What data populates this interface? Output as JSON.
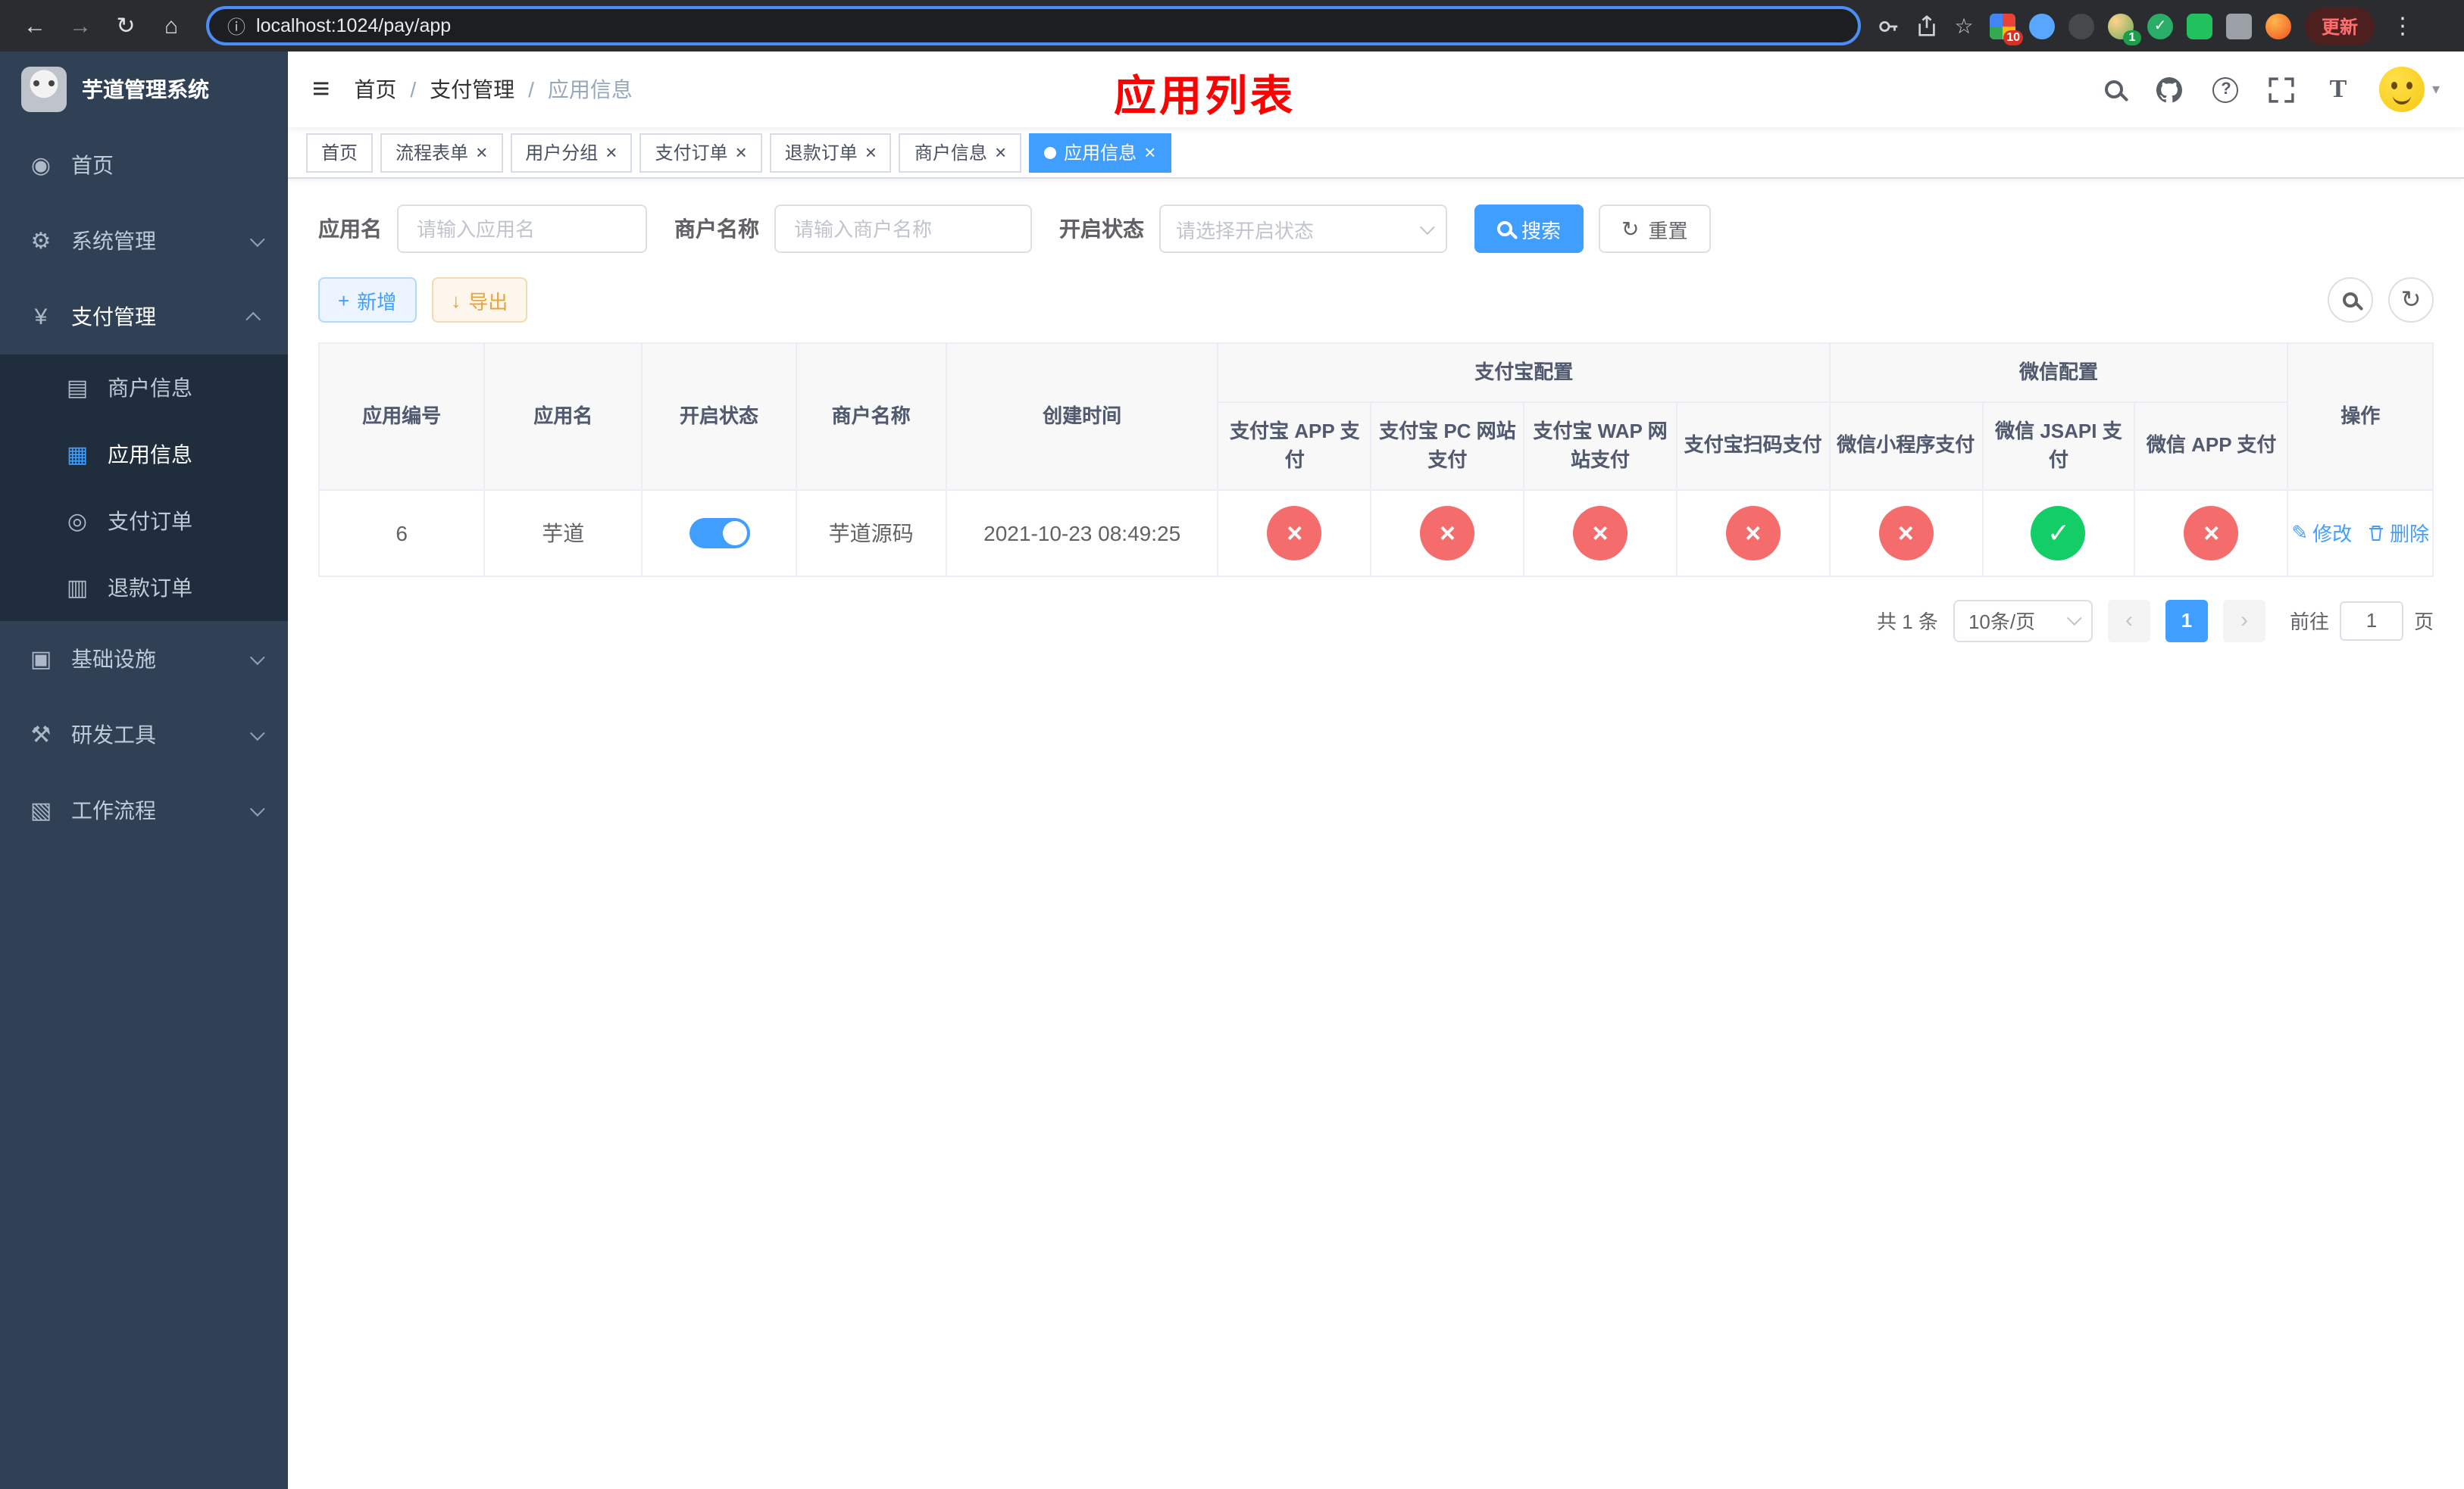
{
  "browser": {
    "url": "localhost:1024/pay/app",
    "update_label": "更新",
    "ext_badge_grid": "10",
    "ext_badge_avatar": "1"
  },
  "sidebar": {
    "app_title": "芋道管理系统",
    "items": [
      {
        "label": "首页",
        "icon": "dashboard-icon"
      },
      {
        "label": "系统管理",
        "icon": "gear-icon"
      },
      {
        "label": "支付管理",
        "icon": "yen-icon"
      },
      {
        "label": "商户信息",
        "icon": "merchant-card-icon"
      },
      {
        "label": "应用信息",
        "icon": "app-grid-icon"
      },
      {
        "label": "支付订单",
        "icon": "pay-order-icon"
      },
      {
        "label": "退款订单",
        "icon": "refund-order-icon"
      },
      {
        "label": "基础设施",
        "icon": "infrastructure-icon"
      },
      {
        "label": "研发工具",
        "icon": "devtools-icon"
      },
      {
        "label": "工作流程",
        "icon": "workflow-icon"
      }
    ]
  },
  "header": {
    "breadcrumb": [
      "首页",
      "支付管理",
      "应用信息"
    ],
    "page_title": "应用列表"
  },
  "tabs": [
    {
      "label": "首页"
    },
    {
      "label": "流程表单"
    },
    {
      "label": "用户分组"
    },
    {
      "label": "支付订单"
    },
    {
      "label": "退款订单"
    },
    {
      "label": "商户信息"
    },
    {
      "label": "应用信息"
    }
  ],
  "filters": {
    "app_name_label": "应用名",
    "app_name_placeholder": "请输入应用名",
    "merchant_label": "商户名称",
    "merchant_placeholder": "请输入商户名称",
    "status_label": "开启状态",
    "status_placeholder": "请选择开启状态",
    "search_label": "搜索",
    "reset_label": "重置"
  },
  "toolbar": {
    "add_label": "新增",
    "export_label": "导出"
  },
  "table": {
    "groups": {
      "alipay": "支付宝配置",
      "wechat": "微信配置"
    },
    "headers": {
      "app_id": "应用编号",
      "app_name": "应用名",
      "status": "开启状态",
      "merchant": "商户名称",
      "created": "创建时间",
      "alipay_app": "支付宝 APP 支付",
      "alipay_pc": "支付宝 PC 网站支付",
      "alipay_wap": "支付宝 WAP 网站支付",
      "alipay_qr": "支付宝扫码支付",
      "wx_mini": "微信小程序支付",
      "wx_jsapi": "微信 JSAPI 支付",
      "wx_app": "微信 APP 支付",
      "actions": "操作"
    },
    "rows": [
      {
        "id": "6",
        "name": "芋道",
        "enabled": true,
        "merchant": "芋道源码",
        "created": "2021-10-23 08:49:25",
        "configs": [
          "no",
          "no",
          "no",
          "no",
          "no",
          "yes",
          "no"
        ],
        "edit_label": "修改",
        "delete_label": "删除"
      }
    ]
  },
  "pagination": {
    "total_text": "共 1 条",
    "page_size": "10条/页",
    "current_page": "1",
    "goto_prefix": "前往",
    "goto_suffix": "页",
    "goto_value": "1"
  }
}
